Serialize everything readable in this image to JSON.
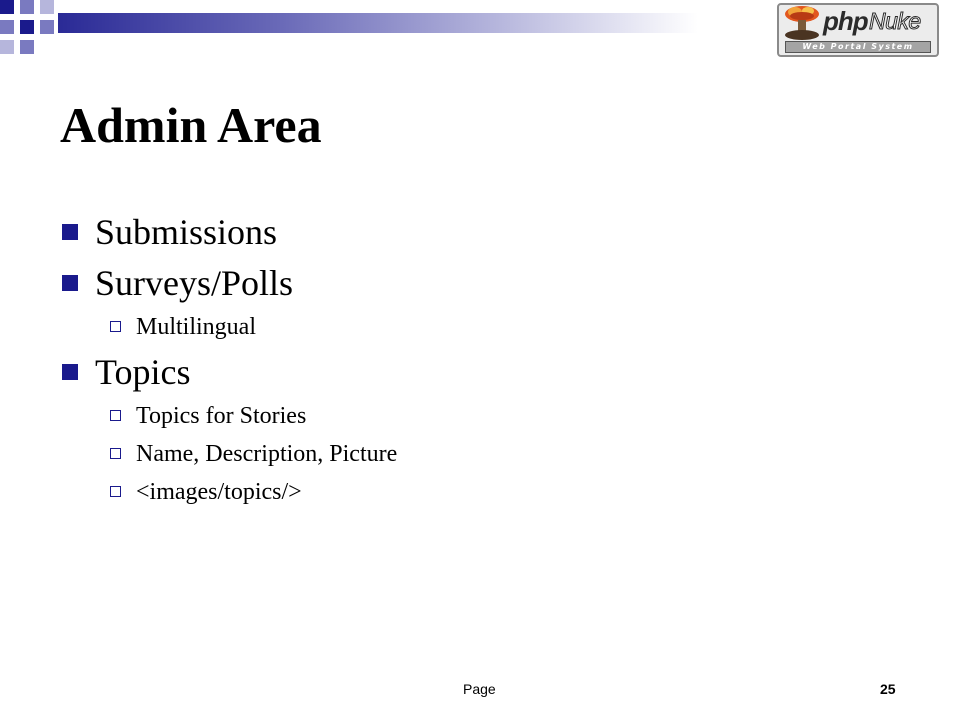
{
  "logo": {
    "brand": "php",
    "product": "Nuke",
    "tagline": "Web Portal System"
  },
  "slide": {
    "title": "Admin Area",
    "bullets": [
      {
        "text": "Submissions",
        "level": 1
      },
      {
        "text": "Surveys/Polls",
        "level": 1
      },
      {
        "text": "Multilingual",
        "level": 2
      },
      {
        "text": "Topics",
        "level": 1
      },
      {
        "text": "Topics for Stories",
        "level": 2
      },
      {
        "text": "Name, Description, Picture",
        "level": 2
      },
      {
        "text": "<images/topics/>",
        "level": 2
      }
    ]
  },
  "footer": {
    "page_label": "Page",
    "page_number": "25"
  },
  "colors": {
    "accent": "#1a1a8c",
    "background": "#ffffff",
    "text": "#000000"
  }
}
